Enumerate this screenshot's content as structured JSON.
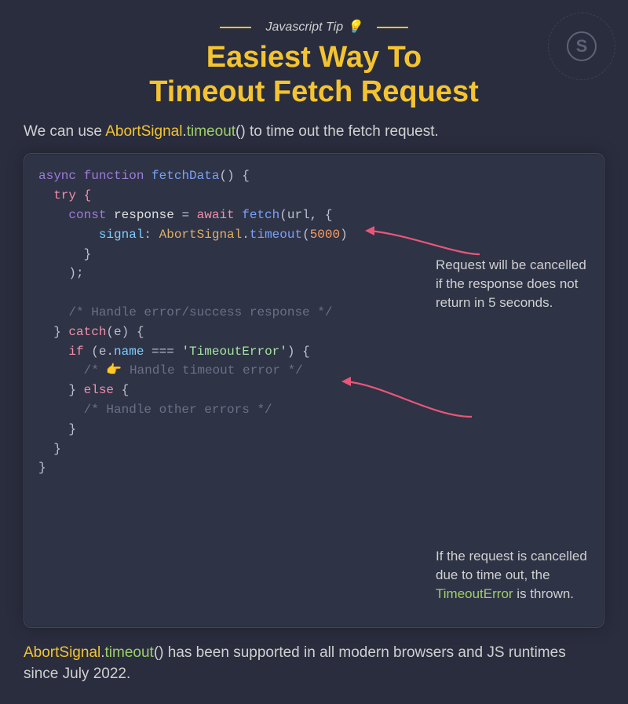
{
  "kicker": "Javascript Tip 💡",
  "title_line1": "Easiest Way To",
  "title_line2": "Timeout Fetch Request",
  "intro_pre": "We can use ",
  "intro_class": "AbortSignal",
  "intro_dot": ".",
  "intro_method": "timeout",
  "intro_post": "() to time out the fetch request.",
  "code": {
    "l1_async": "async ",
    "l1_function": "function ",
    "l1_name": "fetchData",
    "l1_tail": "() {",
    "l2": "  try {",
    "l3_a": "    const ",
    "l3_b": "response ",
    "l3_c": "= ",
    "l3_d": "await ",
    "l3_e": "fetch",
    "l3_f": "(url, {",
    "l4_a": "        signal",
    "l4_b": ": ",
    "l4_c": "AbortSignal",
    "l4_d": ".",
    "l4_e": "timeout",
    "l4_f": "(",
    "l4_g": "5000",
    "l4_h": ")",
    "l5": "      }",
    "l6": "    );",
    "blank": "",
    "l7": "    /* Handle error/success response */",
    "l8_a": "  } ",
    "l8_b": "catch",
    "l8_c": "(e) {",
    "l9_a": "    if ",
    "l9_b": "(e.",
    "l9_c": "name ",
    "l9_d": "=== ",
    "l9_e": "'TimeoutError'",
    "l9_f": ") {",
    "l10": "      /* 👉 Handle timeout error */",
    "l11_a": "    } ",
    "l11_b": "else ",
    "l11_c": "{",
    "l12": "      /* Handle other errors */",
    "l13": "    }",
    "l14": "  }",
    "l15": "}"
  },
  "callout1": "Request will be cancelled if the response does not return in 5 seconds.",
  "callout2_pre": "If the request is cancelled due to time out, the ",
  "callout2_err": "TimeoutError",
  "callout2_post": " is thrown.",
  "footer_class": "AbortSignal",
  "footer_dot": ".",
  "footer_method": "timeout",
  "footer_rest": "() has been supported in all modern browsers and JS runtimes since July 2022.",
  "badge_letter": "S",
  "badge_ring": "· BY SHRIPAL SONI · WWW.CODEWITHSHRIPAL.COM"
}
